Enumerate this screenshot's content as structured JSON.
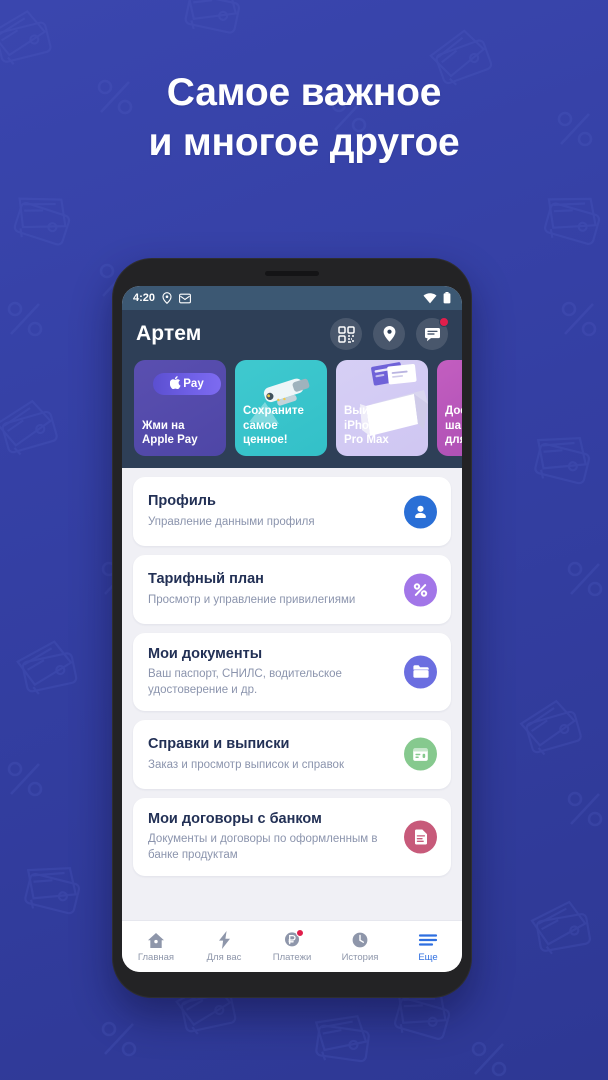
{
  "promo": {
    "headline_line1": "Самое важное",
    "headline_line2": "и многое другое",
    "background_color": "#343fa3",
    "text_color": "#ffffff"
  },
  "phone": {
    "status_bar": {
      "time": "4:20",
      "left_icons": [
        "location-icon",
        "mail-icon"
      ],
      "right_icons": [
        "wifi-icon",
        "battery-icon"
      ],
      "background_color": "#3c5873"
    },
    "app_header": {
      "user_name": "Артем",
      "background_color": "#2e3f57",
      "actions": [
        {
          "name": "qr-scanner-button",
          "icon": "qr-code-icon",
          "badge": false
        },
        {
          "name": "map-location-button",
          "icon": "location-pin-icon",
          "badge": false
        },
        {
          "name": "chat-button",
          "icon": "chat-bubble-icon",
          "badge": true
        }
      ]
    },
    "stories": [
      {
        "id": "apple-pay",
        "text": "Жми на\nApple Pay",
        "badge_label": "Pay",
        "color": "#4e46a6",
        "art": "apple-pay-pill"
      },
      {
        "id": "save-valuables",
        "text": "Сохраните\nсамое\nценное!",
        "color": "#33c0c8",
        "art": "cctv-camera"
      },
      {
        "id": "win-iphone",
        "text": "Выиграй\niPhone 11\nPro Max",
        "color": "#cfc6f2",
        "art": "open-box"
      },
      {
        "id": "affordable-step",
        "text": "Дос\nша\nдля",
        "color": "#a94db2",
        "art": "none"
      }
    ],
    "menu_items": [
      {
        "title": "Профиль",
        "subtitle": "Управление данными профиля",
        "icon": "person-icon",
        "icon_color": "#2a6fd6"
      },
      {
        "title": "Тарифный план",
        "subtitle": "Просмотр и управление привилегиями",
        "icon": "percent-icon",
        "icon_color": "#a276e8"
      },
      {
        "title": "Мои документы",
        "subtitle": "Ваш паспорт, СНИЛС, водительское удостоверение и др.",
        "icon": "folder-icon",
        "icon_color": "#6b6ee0"
      },
      {
        "title": "Справки и выписки",
        "subtitle": "Заказ и просмотр выписок и справок",
        "icon": "statement-card-icon",
        "icon_color": "#86c98e"
      },
      {
        "title": "Мои договоры с банком",
        "subtitle": "Документы и договоры по оформленным в банке продуктам",
        "icon": "document-icon",
        "icon_color": "#c75a7a"
      }
    ],
    "bottom_nav": {
      "active_color": "#2f6fe0",
      "inactive_color": "#8e96aa",
      "items": [
        {
          "label": "Главная",
          "icon": "home-icon",
          "active": false,
          "badge": false
        },
        {
          "label": "Для вас",
          "icon": "lightning-icon",
          "active": false,
          "badge": false
        },
        {
          "label": "Платежи",
          "icon": "ruble-payment-icon",
          "active": false,
          "badge": true
        },
        {
          "label": "История",
          "icon": "clock-icon",
          "active": false,
          "badge": false
        },
        {
          "label": "Еще",
          "icon": "hamburger-menu-icon",
          "active": true,
          "badge": false
        }
      ]
    }
  }
}
